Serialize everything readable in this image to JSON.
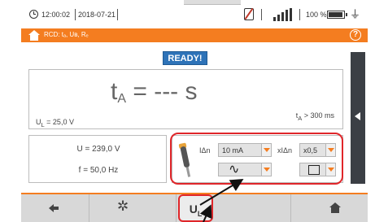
{
  "status_bar": {
    "time": "12:00:02",
    "date": "2018-07-21",
    "battery_percent": "100 %",
    "icons": [
      "clock-icon",
      "no-sim-icon",
      "signal-icon",
      "battery-icon",
      "plug-icon"
    ]
  },
  "title_bar": {
    "title": "RCD: tₐ, Uʙ, Rₑ",
    "icons": [
      "home-icon",
      "help-icon"
    ],
    "help_glyph": "?",
    "color": "#f47d20"
  },
  "status_badge": {
    "label": "READY!",
    "color": "#2e73b8"
  },
  "result": {
    "symbol": "t",
    "symbol_sub": "A",
    "value": " = --- s",
    "ul_label": "U",
    "ul_sub": "L",
    "ul_value": " = 25,0 V",
    "limit_symbol": "t",
    "limit_sub": "A",
    "limit_value": " > 300 ms"
  },
  "measurements": {
    "voltage": "U = 239,0 V",
    "frequency": "f = 50,0 Hz"
  },
  "settings": {
    "idn_label": "IΔn",
    "idn_value": "10 mA",
    "multiplier_label": "xIΔn",
    "multiplier_value": "x0,5",
    "waveform": "∿",
    "waveform_icon": "sine-wave-icon",
    "start_mode_icon": "square-icon",
    "highlight_color": "#e0262a"
  },
  "nav": {
    "back_icon": "back-arrow-icon",
    "tools_icon": "tools-icon",
    "tools_glyph": "✲",
    "ul_label": "U",
    "ul_sub": "L",
    "home_icon": "home-icon"
  }
}
